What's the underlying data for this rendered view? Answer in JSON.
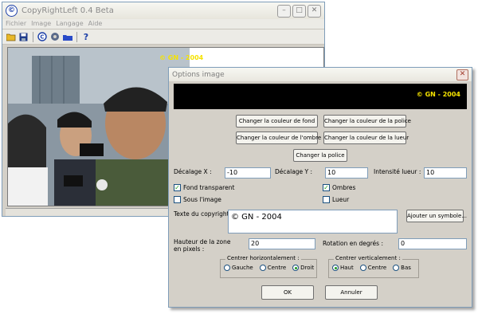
{
  "main_window": {
    "title": "CopyRightLeft 0.4 Beta",
    "app_icon": "©",
    "menu": [
      "Fichier",
      "Image",
      "Langage",
      "Aide"
    ],
    "photo_caption": "© GN - 2004",
    "toolbar_icons": [
      "open-folder-icon",
      "save-disk-icon",
      "copyright-icon",
      "image-options-icon",
      "folder-batch-icon",
      "help-icon"
    ]
  },
  "dialog": {
    "title": "Options image",
    "preview_text": "© GN - 2004",
    "buttons": {
      "bg_color": "Changer la couleur de fond",
      "font_color": "Changer la couleur de la police",
      "shadow_color": "Changer la couleur de l'ombre",
      "glow_color": "Changer la couleur de la lueur",
      "font": "Changer la police",
      "add_symbol": "Ajouter un symbole...",
      "ok": "OK",
      "cancel": "Annuler"
    },
    "offset_x": {
      "label": "Décalage X :",
      "value": "-10"
    },
    "offset_y": {
      "label": "Décalage Y :",
      "value": "10"
    },
    "glow_intensity": {
      "label": "Intensité lueur :",
      "value": "10"
    },
    "checkboxes": {
      "transparent_bg": {
        "label": "Fond transparent",
        "checked": true
      },
      "shadows": {
        "label": "Ombres",
        "checked": true
      },
      "under_image": {
        "label": "Sous l'image",
        "checked": false
      },
      "glow": {
        "label": "Lueur",
        "checked": false
      }
    },
    "copyright_text": {
      "label": "Texte du copyright :",
      "value": "© GN - 2004"
    },
    "zone_height": {
      "label": "Hauteur de la zone en pixels :",
      "value": "20"
    },
    "rotation": {
      "label": "Rotation en degrés :",
      "value": "0"
    },
    "h_center": {
      "title": "Centrer horizontalement :",
      "options": [
        "Gauche",
        "Centre",
        "Droit"
      ],
      "selected": "Droit"
    },
    "v_center": {
      "title": "Centrer verticalement :",
      "options": [
        "Haut",
        "Centre",
        "Bas"
      ],
      "selected": "Haut"
    }
  },
  "colors": {
    "preview_bg": "#000000",
    "caption_yellow": "#f5e300",
    "face": "#d4d0c8"
  }
}
